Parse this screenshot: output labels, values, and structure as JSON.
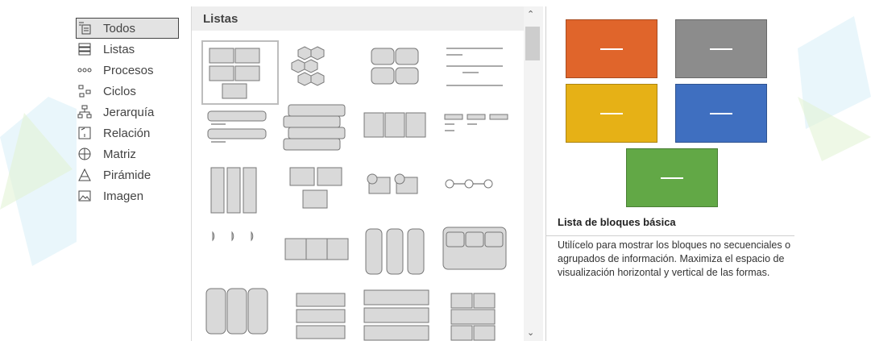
{
  "sidebar": {
    "items": [
      {
        "label": "Todos",
        "icon": "all-icon",
        "selected": true
      },
      {
        "label": "Listas",
        "icon": "list-icon",
        "selected": false
      },
      {
        "label": "Procesos",
        "icon": "process-icon",
        "selected": false
      },
      {
        "label": "Ciclos",
        "icon": "cycle-icon",
        "selected": false
      },
      {
        "label": "Jerarquía",
        "icon": "hierarchy-icon",
        "selected": false
      },
      {
        "label": "Relación",
        "icon": "relationship-icon",
        "selected": false
      },
      {
        "label": "Matriz",
        "icon": "matrix-icon",
        "selected": false
      },
      {
        "label": "Pirámide",
        "icon": "pyramid-icon",
        "selected": false
      },
      {
        "label": "Imagen",
        "icon": "picture-icon",
        "selected": false
      }
    ]
  },
  "gallery": {
    "title": "Listas",
    "layouts": [
      "basic-block-list",
      "hexagon-cluster",
      "grouped-blocks",
      "lined-list",
      "vertical-bullet-list",
      "stacked-list",
      "horizontal-bullet-list",
      "table-list",
      "vertical-box-list",
      "picture-caption-list",
      "circle-label-list",
      "process-circles",
      "half-circle-list",
      "chevron-list",
      "vertical-picture-list",
      "grid-matrix",
      "circle-arrow-list",
      "tab-list",
      "picture-lined-list",
      "segmented-table"
    ]
  },
  "preview": {
    "title": "Lista de bloques básica",
    "description": "Utilícelo para mostrar los bloques no secuenciales o agrupados de información. Maximiza el espacio de visualización horizontal y vertical de las formas.",
    "colors": [
      "#e0652b",
      "#8c8c8c",
      "#e6b116",
      "#3f6fc0",
      "#62a846"
    ]
  }
}
